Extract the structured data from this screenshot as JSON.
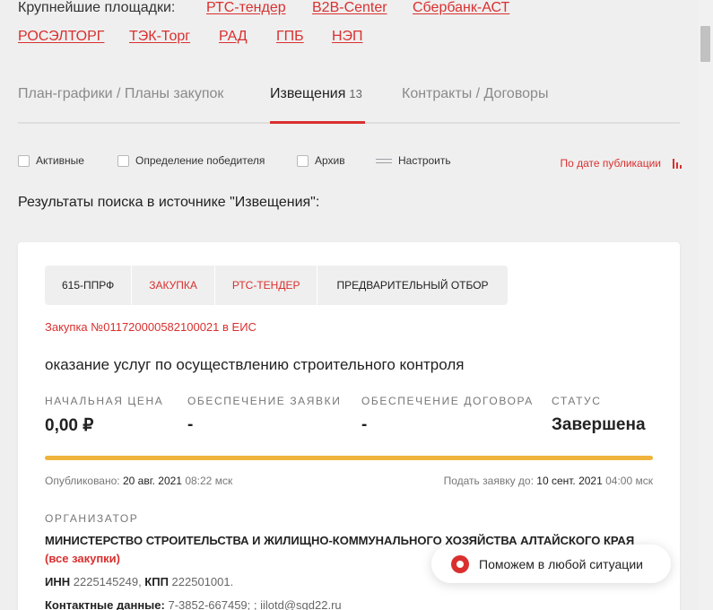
{
  "platforms": {
    "label": "Крупнейшие площадки:",
    "links": [
      "РТС-тендер",
      "B2B-Center",
      "Сбербанк-АСТ",
      "РОСЭЛТОРГ",
      "ТЭК-Торг",
      "РАД",
      "ГПБ",
      "НЭП"
    ]
  },
  "tabs": [
    {
      "label": "План-графики / Планы закупок"
    },
    {
      "label": "Извещения",
      "count": "13"
    },
    {
      "label": "Контракты / Договоры"
    }
  ],
  "filters": {
    "active": "Активные",
    "winner": "Определение победителя",
    "archive": "Архив",
    "configure": "Настроить",
    "sort": "По дате публикации"
  },
  "results_title": "Результаты поиска в источнике \"Извещения\":",
  "card": {
    "chips": [
      "615-ППРФ",
      "ЗАКУПКА",
      "РТС-ТЕНДЕР",
      "ПРЕДВАРИТЕЛЬНЫЙ ОТБОР"
    ],
    "eis_link": "Закупка №0117200005821000​21 в ЕИС",
    "title": "оказание услуг по осуществлению строительного контроля",
    "stats": [
      {
        "label": "НАЧАЛЬНАЯ ЦЕНА",
        "value": "0,00 ₽"
      },
      {
        "label": "ОБЕСПЕЧЕНИЕ ЗАЯВКИ",
        "value": "-"
      },
      {
        "label": "ОБЕСПЕЧЕНИЕ ДОГОВОРА",
        "value": "-"
      },
      {
        "label": "СТАТУС",
        "value": "Завершена"
      }
    ],
    "progress_fraction": 1.0,
    "published_label": "Опубликовано:",
    "published_date": "20 авг. 2021",
    "published_time": "08:22 мск",
    "deadline_label": "Подать заявку до:",
    "deadline_date": "10 сент. 2021",
    "deadline_time": "04:00 мск",
    "organizer_label": "ОРГАНИЗАТОР",
    "organizer_name": "МИНИСТЕРСТВО СТРОИТЕЛЬСТВА И ЖИЛИЩНО-КОММУНАЛЬНОГО ХОЗЯЙСТВА АЛТАЙСКОГО КРАЯ",
    "all_purchases": "(все закупки)",
    "inn_label": "ИНН",
    "inn": "2225145249",
    "kpp_label": "КПП",
    "kpp": "222501001.",
    "contacts_label": "Контактные данные:",
    "contacts": "7-3852-667459; ; iilotd@sgd22.ru"
  },
  "help_widget": "Поможем в любой ситуации",
  "colors": {
    "accent": "#d9302f",
    "progress": "#f0b43c"
  }
}
